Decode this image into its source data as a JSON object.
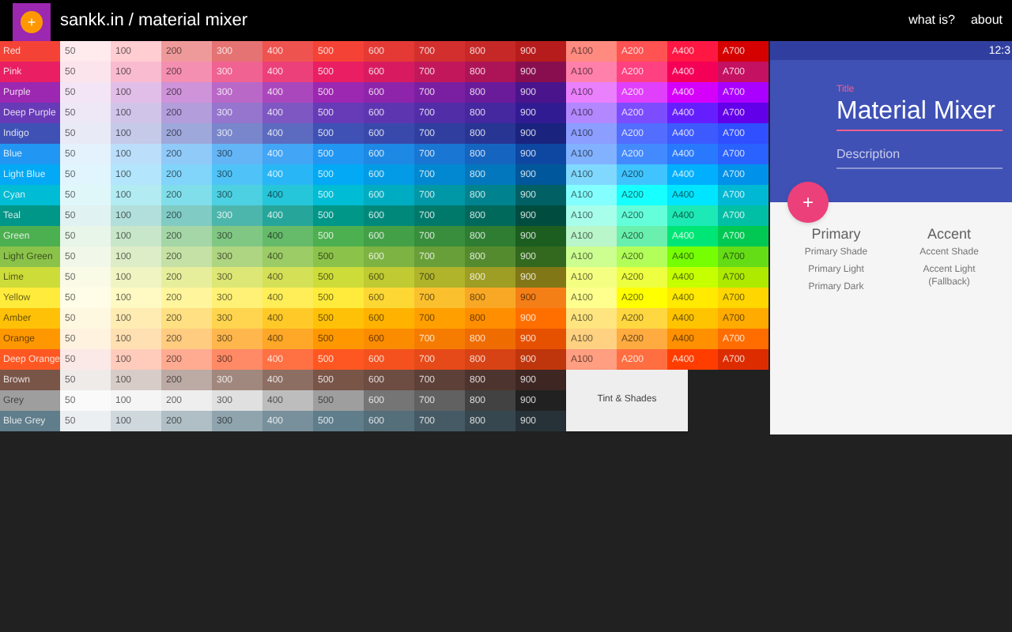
{
  "header": {
    "logo_symbol": "+",
    "title": "sankk.in / material mixer",
    "nav": [
      {
        "label": "what is?"
      },
      {
        "label": "about"
      }
    ]
  },
  "palette": [
    {
      "name": "Red",
      "color": "#f44336",
      "shades": [
        {
          "label": "50",
          "color": "#ffebee"
        },
        {
          "label": "100",
          "color": "#ffcdd2"
        },
        {
          "label": "200",
          "color": "#ef9a9a"
        },
        {
          "label": "300",
          "color": "#e57373"
        },
        {
          "label": "400",
          "color": "#ef5350"
        },
        {
          "label": "500",
          "color": "#f44336"
        },
        {
          "label": "600",
          "color": "#e53935"
        },
        {
          "label": "700",
          "color": "#d32f2f"
        },
        {
          "label": "800",
          "color": "#c62828"
        },
        {
          "label": "900",
          "color": "#b71c1c"
        }
      ],
      "accents": [
        {
          "label": "A100",
          "color": "#ff8a80"
        },
        {
          "label": "A200",
          "color": "#ff5252"
        },
        {
          "label": "A400",
          "color": "#ff1744"
        },
        {
          "label": "A700",
          "color": "#d50000"
        }
      ]
    },
    {
      "name": "Pink",
      "color": "#e91e63",
      "shades": [
        {
          "label": "50",
          "color": "#fce4ec"
        },
        {
          "label": "100",
          "color": "#f8bbd0"
        },
        {
          "label": "200",
          "color": "#f48fb1"
        },
        {
          "label": "300",
          "color": "#f06292"
        },
        {
          "label": "400",
          "color": "#ec407a"
        },
        {
          "label": "500",
          "color": "#e91e63"
        },
        {
          "label": "600",
          "color": "#d81b60"
        },
        {
          "label": "700",
          "color": "#c2185b"
        },
        {
          "label": "800",
          "color": "#ad1457"
        },
        {
          "label": "900",
          "color": "#880e4f"
        }
      ],
      "accents": [
        {
          "label": "A100",
          "color": "#ff80ab"
        },
        {
          "label": "A200",
          "color": "#ff4081"
        },
        {
          "label": "A400",
          "color": "#f50057"
        },
        {
          "label": "A700",
          "color": "#c51162"
        }
      ]
    },
    {
      "name": "Purple",
      "color": "#9c27b0",
      "shades": [
        {
          "label": "50",
          "color": "#f3e5f5"
        },
        {
          "label": "100",
          "color": "#e1bee7"
        },
        {
          "label": "200",
          "color": "#ce93d8"
        },
        {
          "label": "300",
          "color": "#ba68c8"
        },
        {
          "label": "400",
          "color": "#ab47bc"
        },
        {
          "label": "500",
          "color": "#9c27b0"
        },
        {
          "label": "600",
          "color": "#8e24aa"
        },
        {
          "label": "700",
          "color": "#7b1fa2"
        },
        {
          "label": "800",
          "color": "#6a1b9a"
        },
        {
          "label": "900",
          "color": "#4a148c"
        }
      ],
      "accents": [
        {
          "label": "A100",
          "color": "#ea80fc"
        },
        {
          "label": "A200",
          "color": "#e040fb"
        },
        {
          "label": "A400",
          "color": "#d500f9"
        },
        {
          "label": "A700",
          "color": "#aa00ff"
        }
      ]
    },
    {
      "name": "Deep Purple",
      "color": "#673ab7",
      "shades": [
        {
          "label": "50",
          "color": "#ede7f6"
        },
        {
          "label": "100",
          "color": "#d1c4e9"
        },
        {
          "label": "200",
          "color": "#b39ddb"
        },
        {
          "label": "300",
          "color": "#9575cd"
        },
        {
          "label": "400",
          "color": "#7e57c2"
        },
        {
          "label": "500",
          "color": "#673ab7"
        },
        {
          "label": "600",
          "color": "#5e35b1"
        },
        {
          "label": "700",
          "color": "#512da8"
        },
        {
          "label": "800",
          "color": "#4527a0"
        },
        {
          "label": "900",
          "color": "#311b92"
        }
      ],
      "accents": [
        {
          "label": "A100",
          "color": "#b388ff"
        },
        {
          "label": "A200",
          "color": "#7c4dff"
        },
        {
          "label": "A400",
          "color": "#651fff"
        },
        {
          "label": "A700",
          "color": "#6200ea"
        }
      ]
    },
    {
      "name": "Indigo",
      "color": "#3f51b5",
      "shades": [
        {
          "label": "50",
          "color": "#e8eaf6"
        },
        {
          "label": "100",
          "color": "#c5cae9"
        },
        {
          "label": "200",
          "color": "#9fa8da"
        },
        {
          "label": "300",
          "color": "#7986cb"
        },
        {
          "label": "400",
          "color": "#5c6bc0"
        },
        {
          "label": "500",
          "color": "#3f51b5"
        },
        {
          "label": "600",
          "color": "#3949ab"
        },
        {
          "label": "700",
          "color": "#303f9f"
        },
        {
          "label": "800",
          "color": "#283593"
        },
        {
          "label": "900",
          "color": "#1a237e"
        }
      ],
      "accents": [
        {
          "label": "A100",
          "color": "#8c9eff"
        },
        {
          "label": "A200",
          "color": "#536dfe"
        },
        {
          "label": "A400",
          "color": "#3d5afe"
        },
        {
          "label": "A700",
          "color": "#304ffe"
        }
      ]
    },
    {
      "name": "Blue",
      "color": "#2196f3",
      "shades": [
        {
          "label": "50",
          "color": "#e3f2fd"
        },
        {
          "label": "100",
          "color": "#bbdefb"
        },
        {
          "label": "200",
          "color": "#90caf9"
        },
        {
          "label": "300",
          "color": "#64b5f6"
        },
        {
          "label": "400",
          "color": "#42a5f5"
        },
        {
          "label": "500",
          "color": "#2196f3"
        },
        {
          "label": "600",
          "color": "#1e88e5"
        },
        {
          "label": "700",
          "color": "#1976d2"
        },
        {
          "label": "800",
          "color": "#1565c0"
        },
        {
          "label": "900",
          "color": "#0d47a1"
        }
      ],
      "accents": [
        {
          "label": "A100",
          "color": "#82b1ff"
        },
        {
          "label": "A200",
          "color": "#448aff"
        },
        {
          "label": "A400",
          "color": "#2979ff"
        },
        {
          "label": "A700",
          "color": "#2962ff"
        }
      ]
    },
    {
      "name": "Light Blue",
      "color": "#03a9f4",
      "shades": [
        {
          "label": "50",
          "color": "#e1f5fe"
        },
        {
          "label": "100",
          "color": "#b3e5fc"
        },
        {
          "label": "200",
          "color": "#81d4fa"
        },
        {
          "label": "300",
          "color": "#4fc3f7"
        },
        {
          "label": "400",
          "color": "#29b6f6"
        },
        {
          "label": "500",
          "color": "#03a9f4"
        },
        {
          "label": "600",
          "color": "#039be5"
        },
        {
          "label": "700",
          "color": "#0288d1"
        },
        {
          "label": "800",
          "color": "#0277bd"
        },
        {
          "label": "900",
          "color": "#01579b"
        }
      ],
      "accents": [
        {
          "label": "A100",
          "color": "#80d8ff"
        },
        {
          "label": "A200",
          "color": "#40c4ff"
        },
        {
          "label": "A400",
          "color": "#00b0ff"
        },
        {
          "label": "A700",
          "color": "#0091ea"
        }
      ]
    },
    {
      "name": "Cyan",
      "color": "#00bcd4",
      "shades": [
        {
          "label": "50",
          "color": "#e0f7fa"
        },
        {
          "label": "100",
          "color": "#b2ebf2"
        },
        {
          "label": "200",
          "color": "#80deea"
        },
        {
          "label": "300",
          "color": "#4dd0e1"
        },
        {
          "label": "400",
          "color": "#26c6da"
        },
        {
          "label": "500",
          "color": "#00bcd4"
        },
        {
          "label": "600",
          "color": "#00acc1"
        },
        {
          "label": "700",
          "color": "#0097a7"
        },
        {
          "label": "800",
          "color": "#00838f"
        },
        {
          "label": "900",
          "color": "#006064"
        }
      ],
      "accents": [
        {
          "label": "A100",
          "color": "#84ffff"
        },
        {
          "label": "A200",
          "color": "#18ffff"
        },
        {
          "label": "A400",
          "color": "#00e5ff"
        },
        {
          "label": "A700",
          "color": "#00b8d4"
        }
      ]
    },
    {
      "name": "Teal",
      "color": "#009688",
      "shades": [
        {
          "label": "50",
          "color": "#e0f2f1"
        },
        {
          "label": "100",
          "color": "#b2dfdb"
        },
        {
          "label": "200",
          "color": "#80cbc4"
        },
        {
          "label": "300",
          "color": "#4db6ac"
        },
        {
          "label": "400",
          "color": "#26a69a"
        },
        {
          "label": "500",
          "color": "#009688"
        },
        {
          "label": "600",
          "color": "#00897b"
        },
        {
          "label": "700",
          "color": "#00796b"
        },
        {
          "label": "800",
          "color": "#00695c"
        },
        {
          "label": "900",
          "color": "#004d40"
        }
      ],
      "accents": [
        {
          "label": "A100",
          "color": "#a7ffeb"
        },
        {
          "label": "A200",
          "color": "#64ffda"
        },
        {
          "label": "A400",
          "color": "#1de9b6"
        },
        {
          "label": "A700",
          "color": "#00bfa5"
        }
      ]
    },
    {
      "name": "Green",
      "color": "#4caf50",
      "shades": [
        {
          "label": "50",
          "color": "#e8f5e9"
        },
        {
          "label": "100",
          "color": "#c8e6c9"
        },
        {
          "label": "200",
          "color": "#a5d6a7"
        },
        {
          "label": "300",
          "color": "#81c784"
        },
        {
          "label": "400",
          "color": "#66bb6a"
        },
        {
          "label": "500",
          "color": "#4caf50"
        },
        {
          "label": "600",
          "color": "#43a047"
        },
        {
          "label": "700",
          "color": "#388e3c"
        },
        {
          "label": "800",
          "color": "#2e7d32"
        },
        {
          "label": "900",
          "color": "#1b5e20"
        }
      ],
      "accents": [
        {
          "label": "A100",
          "color": "#b9f6ca"
        },
        {
          "label": "A200",
          "color": "#69f0ae"
        },
        {
          "label": "A400",
          "color": "#00e676"
        },
        {
          "label": "A700",
          "color": "#00c853"
        }
      ]
    },
    {
      "name": "Light Green",
      "color": "#8bc34a",
      "shades": [
        {
          "label": "50",
          "color": "#f1f8e9"
        },
        {
          "label": "100",
          "color": "#dcedc8"
        },
        {
          "label": "200",
          "color": "#c5e1a5"
        },
        {
          "label": "300",
          "color": "#aed581"
        },
        {
          "label": "400",
          "color": "#9ccc65"
        },
        {
          "label": "500",
          "color": "#8bc34a"
        },
        {
          "label": "600",
          "color": "#7cb342"
        },
        {
          "label": "700",
          "color": "#689f38"
        },
        {
          "label": "800",
          "color": "#558b2f"
        },
        {
          "label": "900",
          "color": "#33691e"
        }
      ],
      "accents": [
        {
          "label": "A100",
          "color": "#ccff90"
        },
        {
          "label": "A200",
          "color": "#b2ff59"
        },
        {
          "label": "A400",
          "color": "#76ff03"
        },
        {
          "label": "A700",
          "color": "#64dd17"
        }
      ]
    },
    {
      "name": "Lime",
      "color": "#cddc39",
      "shades": [
        {
          "label": "50",
          "color": "#f9fbe7"
        },
        {
          "label": "100",
          "color": "#f0f4c3"
        },
        {
          "label": "200",
          "color": "#e6ee9c"
        },
        {
          "label": "300",
          "color": "#dce775"
        },
        {
          "label": "400",
          "color": "#d4e157"
        },
        {
          "label": "500",
          "color": "#cddc39"
        },
        {
          "label": "600",
          "color": "#c0ca33"
        },
        {
          "label": "700",
          "color": "#afb42b"
        },
        {
          "label": "800",
          "color": "#9e9d24"
        },
        {
          "label": "900",
          "color": "#827717"
        }
      ],
      "accents": [
        {
          "label": "A100",
          "color": "#f4ff81"
        },
        {
          "label": "A200",
          "color": "#eeff41"
        },
        {
          "label": "A400",
          "color": "#c6ff00"
        },
        {
          "label": "A700",
          "color": "#aeea00"
        }
      ]
    },
    {
      "name": "Yellow",
      "color": "#ffeb3b",
      "shades": [
        {
          "label": "50",
          "color": "#fffde7"
        },
        {
          "label": "100",
          "color": "#fff9c4"
        },
        {
          "label": "200",
          "color": "#fff59d"
        },
        {
          "label": "300",
          "color": "#fff176"
        },
        {
          "label": "400",
          "color": "#ffee58"
        },
        {
          "label": "500",
          "color": "#ffeb3b"
        },
        {
          "label": "600",
          "color": "#fdd835"
        },
        {
          "label": "700",
          "color": "#fbc02d"
        },
        {
          "label": "800",
          "color": "#f9a825"
        },
        {
          "label": "900",
          "color": "#f57f17"
        }
      ],
      "accents": [
        {
          "label": "A100",
          "color": "#ffff8d"
        },
        {
          "label": "A200",
          "color": "#ffff00"
        },
        {
          "label": "A400",
          "color": "#ffea00"
        },
        {
          "label": "A700",
          "color": "#ffd600"
        }
      ]
    },
    {
      "name": "Amber",
      "color": "#ffc107",
      "shades": [
        {
          "label": "50",
          "color": "#fff8e1"
        },
        {
          "label": "100",
          "color": "#ffecb3"
        },
        {
          "label": "200",
          "color": "#ffe082"
        },
        {
          "label": "300",
          "color": "#ffd54f"
        },
        {
          "label": "400",
          "color": "#ffca28"
        },
        {
          "label": "500",
          "color": "#ffc107"
        },
        {
          "label": "600",
          "color": "#ffb300"
        },
        {
          "label": "700",
          "color": "#ffa000"
        },
        {
          "label": "800",
          "color": "#ff8f00"
        },
        {
          "label": "900",
          "color": "#ff6f00"
        }
      ],
      "accents": [
        {
          "label": "A100",
          "color": "#ffe57f"
        },
        {
          "label": "A200",
          "color": "#ffd740"
        },
        {
          "label": "A400",
          "color": "#ffc400"
        },
        {
          "label": "A700",
          "color": "#ffab00"
        }
      ]
    },
    {
      "name": "Orange",
      "color": "#ff9800",
      "shades": [
        {
          "label": "50",
          "color": "#fff3e0"
        },
        {
          "label": "100",
          "color": "#ffe0b2"
        },
        {
          "label": "200",
          "color": "#ffcc80"
        },
        {
          "label": "300",
          "color": "#ffb74d"
        },
        {
          "label": "400",
          "color": "#ffa726"
        },
        {
          "label": "500",
          "color": "#ff9800"
        },
        {
          "label": "600",
          "color": "#fb8c00"
        },
        {
          "label": "700",
          "color": "#f57c00"
        },
        {
          "label": "800",
          "color": "#ef6c00"
        },
        {
          "label": "900",
          "color": "#e65100"
        }
      ],
      "accents": [
        {
          "label": "A100",
          "color": "#ffd180"
        },
        {
          "label": "A200",
          "color": "#ffab40"
        },
        {
          "label": "A400",
          "color": "#ff9100"
        },
        {
          "label": "A700",
          "color": "#ff6d00"
        }
      ]
    },
    {
      "name": "Deep Orange",
      "color": "#ff5722",
      "shades": [
        {
          "label": "50",
          "color": "#fbe9e7"
        },
        {
          "label": "100",
          "color": "#ffccbc"
        },
        {
          "label": "200",
          "color": "#ffab91"
        },
        {
          "label": "300",
          "color": "#ff8a65"
        },
        {
          "label": "400",
          "color": "#ff7043"
        },
        {
          "label": "500",
          "color": "#ff5722"
        },
        {
          "label": "600",
          "color": "#f4511e"
        },
        {
          "label": "700",
          "color": "#e64a19"
        },
        {
          "label": "800",
          "color": "#d84315"
        },
        {
          "label": "900",
          "color": "#bf360c"
        }
      ],
      "accents": [
        {
          "label": "A100",
          "color": "#ff9e80"
        },
        {
          "label": "A200",
          "color": "#ff6e40"
        },
        {
          "label": "A400",
          "color": "#ff3d00"
        },
        {
          "label": "A700",
          "color": "#dd2c00"
        }
      ]
    },
    {
      "name": "Brown",
      "color": "#795548",
      "shades": [
        {
          "label": "50",
          "color": "#efebe9"
        },
        {
          "label": "100",
          "color": "#d7ccc8"
        },
        {
          "label": "200",
          "color": "#bcaaa4"
        },
        {
          "label": "300",
          "color": "#a1887f"
        },
        {
          "label": "400",
          "color": "#8d6e63"
        },
        {
          "label": "500",
          "color": "#795548"
        },
        {
          "label": "600",
          "color": "#6d4c41"
        },
        {
          "label": "700",
          "color": "#5d4037"
        },
        {
          "label": "800",
          "color": "#4e342e"
        },
        {
          "label": "900",
          "color": "#3e2723"
        }
      ]
    },
    {
      "name": "Grey",
      "color": "#9e9e9e",
      "shades": [
        {
          "label": "50",
          "color": "#fafafa"
        },
        {
          "label": "100",
          "color": "#f5f5f5"
        },
        {
          "label": "200",
          "color": "#eeeeee"
        },
        {
          "label": "300",
          "color": "#e0e0e0"
        },
        {
          "label": "400",
          "color": "#bdbdbd"
        },
        {
          "label": "500",
          "color": "#9e9e9e"
        },
        {
          "label": "600",
          "color": "#757575"
        },
        {
          "label": "700",
          "color": "#616161"
        },
        {
          "label": "800",
          "color": "#424242"
        },
        {
          "label": "900",
          "color": "#212121"
        }
      ]
    },
    {
      "name": "Blue Grey",
      "color": "#607d8b",
      "shades": [
        {
          "label": "50",
          "color": "#eceff1"
        },
        {
          "label": "100",
          "color": "#cfd8dc"
        },
        {
          "label": "200",
          "color": "#b0bec5"
        },
        {
          "label": "300",
          "color": "#90a4ae"
        },
        {
          "label": "400",
          "color": "#78909c"
        },
        {
          "label": "500",
          "color": "#607d8b"
        },
        {
          "label": "600",
          "color": "#546e7a"
        },
        {
          "label": "700",
          "color": "#455a64"
        },
        {
          "label": "800",
          "color": "#37474f"
        },
        {
          "label": "900",
          "color": "#263238"
        }
      ]
    }
  ],
  "tint_button": {
    "label": "Tint & Shades"
  },
  "preview": {
    "status_time": "12:3",
    "title_label": "Title",
    "title_value": "Material Mixer",
    "description_placeholder": "Description",
    "fab_symbol": "+",
    "columns": [
      {
        "heading": "Primary",
        "items": [
          "Primary Shade",
          "Primary Light",
          "Primary Dark"
        ]
      },
      {
        "heading": "Accent",
        "items": [
          "Accent Shade",
          "Accent Light (Fallback)"
        ]
      }
    ]
  }
}
